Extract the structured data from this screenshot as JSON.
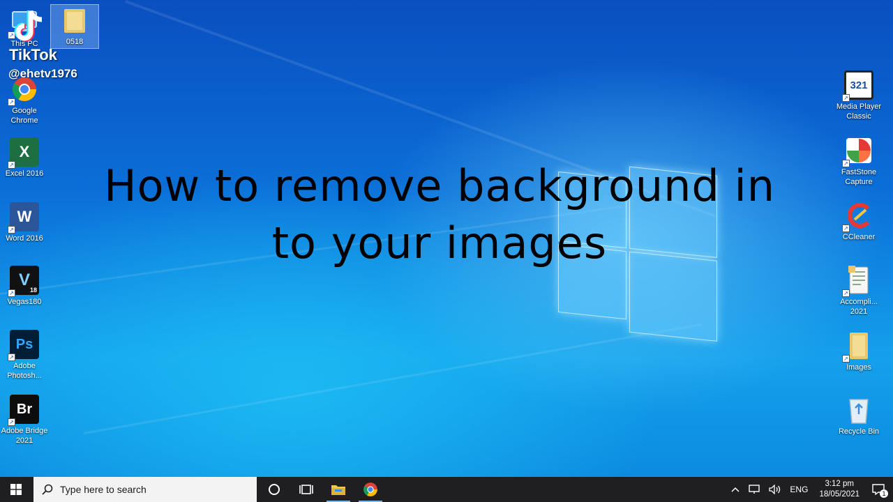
{
  "overlay": {
    "brand": "TikTok",
    "handle": "@ehetv1976"
  },
  "headline": {
    "line1": "How to remove background in",
    "line2": "to your images"
  },
  "desktop_icons_left": [
    {
      "label": "This PC",
      "icon": "this-pc-icon"
    },
    {
      "label": "0518",
      "icon": "folder-icon"
    },
    {
      "label": "Google Chrome",
      "icon": "chrome-icon"
    },
    {
      "label": "Excel 2016",
      "icon": "excel-icon",
      "glyph": "X"
    },
    {
      "label": "Word 2016",
      "icon": "word-icon",
      "glyph": "W"
    },
    {
      "label": "Vegas180",
      "icon": "vegas-icon",
      "glyph": "V"
    },
    {
      "label": "Adobe Photosh...",
      "icon": "photoshop-icon",
      "glyph": "Ps"
    },
    {
      "label": "Adobe Bridge 2021",
      "icon": "bridge-icon",
      "glyph": "Br"
    }
  ],
  "desktop_icons_right": [
    {
      "label": "Media Player Classic",
      "icon": "media-player-icon",
      "glyph": "321"
    },
    {
      "label": "FastStone Capture",
      "icon": "faststone-icon"
    },
    {
      "label": "CCleaner",
      "icon": "ccleaner-icon"
    },
    {
      "label": "Accompli... 2021",
      "icon": "document-icon"
    },
    {
      "label": "Images",
      "icon": "folder-icon"
    },
    {
      "label": "Recycle Bin",
      "icon": "recycle-bin-icon"
    }
  ],
  "vegas_version": "18",
  "taskbar": {
    "search_placeholder": "Type here to search",
    "language": "ENG",
    "time": "3:12 pm",
    "date": "18/05/2021",
    "notification_count": "1"
  },
  "colors": {
    "taskbar": "#1f1f22",
    "accent": "#76b9ed",
    "wallpaper": "#0b6fd8"
  }
}
